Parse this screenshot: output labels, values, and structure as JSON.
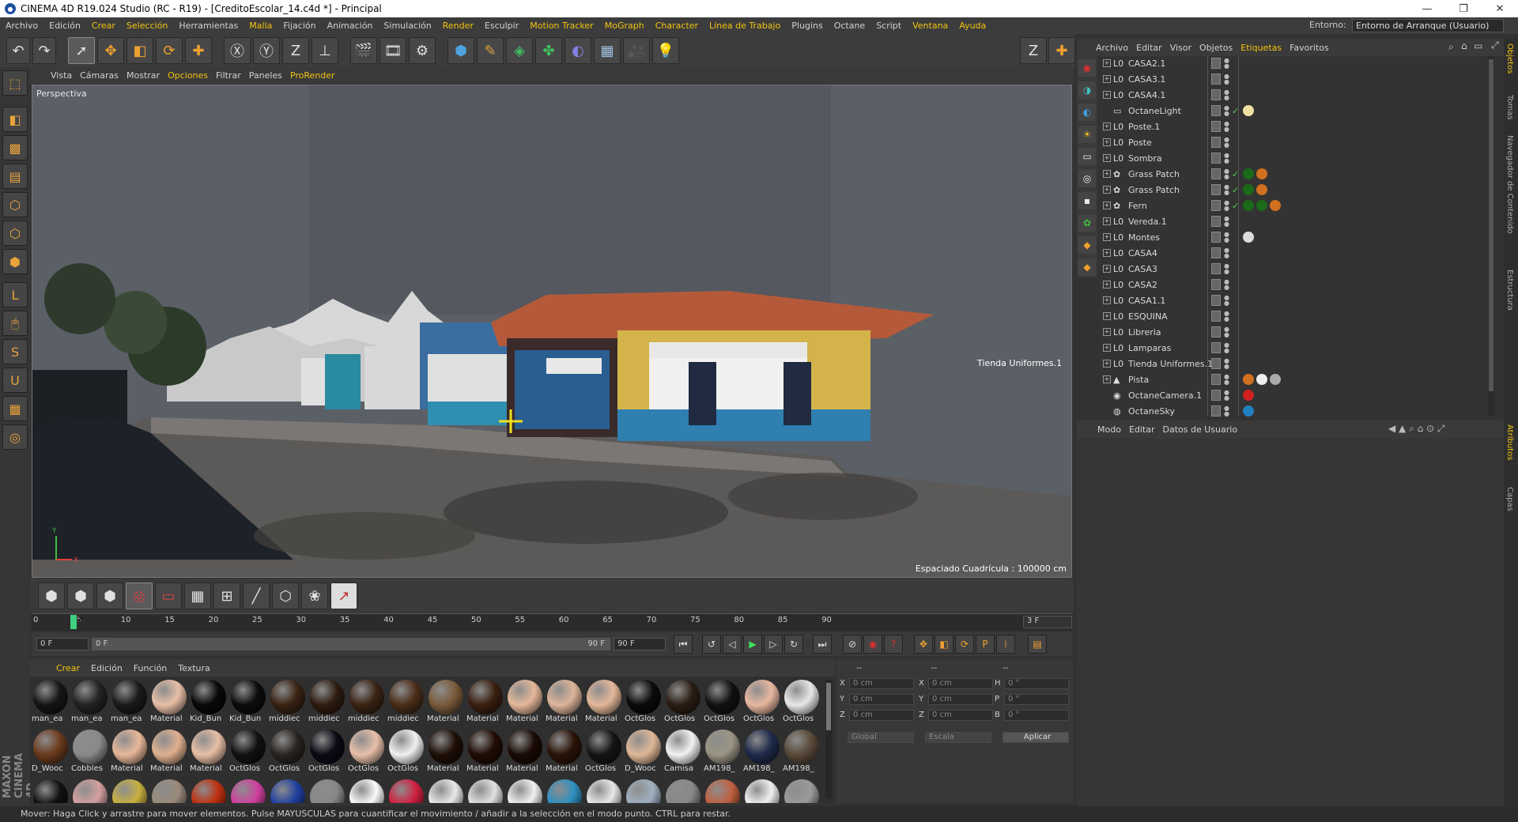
{
  "window": {
    "title": "CINEMA 4D R19.024 Studio (RC - R19) - [CreditoEscolar_14.c4d *] - Principal",
    "minimize": "—",
    "maximize": "❐",
    "close": "✕"
  },
  "menubar": {
    "items": [
      {
        "label": "Archivo",
        "hl": false
      },
      {
        "label": "Edición",
        "hl": false
      },
      {
        "label": "Crear",
        "hl": true
      },
      {
        "label": "Selección",
        "hl": true
      },
      {
        "label": "Herramientas",
        "hl": false
      },
      {
        "label": "Malla",
        "hl": true
      },
      {
        "label": "Fijación",
        "hl": false
      },
      {
        "label": "Animación",
        "hl": false
      },
      {
        "label": "Simulación",
        "hl": false
      },
      {
        "label": "Render",
        "hl": true
      },
      {
        "label": "Esculpir",
        "hl": false
      },
      {
        "label": "Motion Tracker",
        "hl": true
      },
      {
        "label": "MoGraph",
        "hl": true
      },
      {
        "label": "Character",
        "hl": true
      },
      {
        "label": "Línea de Trabajo",
        "hl": true
      },
      {
        "label": "Plugins",
        "hl": false
      },
      {
        "label": "Octane",
        "hl": false
      },
      {
        "label": "Script",
        "hl": false
      },
      {
        "label": "Ventana",
        "hl": true
      },
      {
        "label": "Ayuda",
        "hl": true
      }
    ],
    "env_label": "Entorno:",
    "env_value": "Entorno de Arranque (Usuario)"
  },
  "viewport": {
    "menu": [
      {
        "label": "Vista",
        "hl": false
      },
      {
        "label": "Cámaras",
        "hl": false
      },
      {
        "label": "Mostrar",
        "hl": false
      },
      {
        "label": "Opciones",
        "hl": true
      },
      {
        "label": "Filtrar",
        "hl": false
      },
      {
        "label": "Paneles",
        "hl": false
      },
      {
        "label": "ProRender",
        "hl": true
      }
    ],
    "label": "Perspectiva",
    "grid_info": "Espaciado Cuadrícula : 100000 cm",
    "object_label": "Tienda Uniformes.1"
  },
  "timeline": {
    "ticks": [
      "0",
      "5",
      "10",
      "15",
      "20",
      "25",
      "30",
      "35",
      "40",
      "45",
      "50",
      "55",
      "60",
      "65",
      "70",
      "75",
      "80",
      "85",
      "90"
    ],
    "current": "3",
    "end_field": "3 F",
    "start_frame": "0 F",
    "range_start": "0 F",
    "range_end": "90 F",
    "end_frame": "90 F"
  },
  "material_menu": [
    {
      "label": "Crear",
      "hl": true
    },
    {
      "label": "Edición",
      "hl": false
    },
    {
      "label": "Función",
      "hl": false
    },
    {
      "label": "Textura",
      "hl": false
    }
  ],
  "materials": [
    {
      "name": "man_ea",
      "color": "#151515"
    },
    {
      "name": "man_ea",
      "color": "#222"
    },
    {
      "name": "man_ea",
      "color": "#1a1a1a"
    },
    {
      "name": "Material",
      "color": "#e8bfa6"
    },
    {
      "name": "Kid_Bun",
      "color": "#080808"
    },
    {
      "name": "Kid_Bun",
      "color": "#0c0c0c"
    },
    {
      "name": "middiec",
      "color": "#3a2314"
    },
    {
      "name": "middiec",
      "color": "#2e1c10"
    },
    {
      "name": "middiec",
      "color": "#3a2314"
    },
    {
      "name": "middiec",
      "color": "#4a2d18"
    },
    {
      "name": "Material",
      "color": "#7a5a3a"
    },
    {
      "name": "Material",
      "color": "#3a2010"
    },
    {
      "name": "Material",
      "color": "#e5b89a"
    },
    {
      "name": "Material",
      "color": "#ddb49a"
    },
    {
      "name": "Material",
      "color": "#e5b89a"
    },
    {
      "name": "OctGlos",
      "color": "#0a0a0a"
    },
    {
      "name": "OctGlos",
      "color": "#2b1d14"
    },
    {
      "name": "OctGlos",
      "color": "#111"
    },
    {
      "name": "OctGlos",
      "color": "#e8b8a0"
    },
    {
      "name": "OctGlos",
      "color": "#e8e8e8"
    },
    {
      "name": "D_Wooc",
      "color": "#6b3a1c"
    },
    {
      "name": "Cobbles",
      "color": "#8a8a8a"
    },
    {
      "name": "Material",
      "color": "#e8b89a"
    },
    {
      "name": "Material",
      "color": "#e0b090"
    },
    {
      "name": "Material",
      "color": "#e8bfa6"
    },
    {
      "name": "OctGlos",
      "color": "#111"
    },
    {
      "name": "OctGlos",
      "color": "#2a2420"
    },
    {
      "name": "OctGlos",
      "color": "#0a0a14"
    },
    {
      "name": "OctGlos",
      "color": "#e8bfaa"
    },
    {
      "name": "OctGlos",
      "color": "#f0f0f0"
    },
    {
      "name": "Material",
      "color": "#1e0e06"
    },
    {
      "name": "Material",
      "color": "#200c04"
    },
    {
      "name": "Material",
      "color": "#1a0a04"
    },
    {
      "name": "Material",
      "color": "#2a1408"
    },
    {
      "name": "OctGlos",
      "color": "#151515"
    },
    {
      "name": "D_Wooc",
      "color": "#e0b898"
    },
    {
      "name": "Camisa",
      "color": "#f2f2f2"
    },
    {
      "name": "AM198_",
      "color": "#9a9484"
    },
    {
      "name": "AM198_",
      "color": "#1e2a4a"
    },
    {
      "name": "AM198_",
      "color": "#5a4a3a"
    },
    {
      "name": "",
      "color": "#111"
    },
    {
      "name": "",
      "color": "#d4a0a0"
    },
    {
      "name": "",
      "color": "#c8b040"
    },
    {
      "name": "",
      "color": "#9a8a7a"
    },
    {
      "name": "",
      "color": "#c03010"
    },
    {
      "name": "",
      "color": "#d040a0"
    },
    {
      "name": "",
      "color": "#2040a0"
    },
    {
      "name": "",
      "color": "#888"
    },
    {
      "name": "",
      "color": "#fafafa"
    },
    {
      "name": "",
      "color": "#d02040"
    },
    {
      "name": "",
      "color": "#e8e8e8"
    },
    {
      "name": "",
      "color": "#e0e0e0"
    },
    {
      "name": "",
      "color": "#f0f0f0"
    },
    {
      "name": "",
      "color": "#3090c0"
    },
    {
      "name": "",
      "color": "#e8e8e8"
    },
    {
      "name": "",
      "color": "#a0b0c0"
    },
    {
      "name": "",
      "color": "#888"
    },
    {
      "name": "",
      "color": "#c06040"
    },
    {
      "name": "",
      "color": "#f0f0f0"
    },
    {
      "name": "",
      "color": "#9a9a9a"
    }
  ],
  "coords": {
    "header": [
      "--",
      "--",
      "--"
    ],
    "rows": [
      {
        "a": "X",
        "av": "0 cm",
        "b": "X",
        "bv": "0 cm",
        "c": "H",
        "cv": "0 °"
      },
      {
        "a": "Y",
        "av": "0 cm",
        "b": "Y",
        "bv": "0 cm",
        "c": "P",
        "cv": "0 °"
      },
      {
        "a": "Z",
        "av": "0 cm",
        "b": "Z",
        "bv": "0 cm",
        "c": "B",
        "cv": "0 °"
      }
    ],
    "mode": "Global",
    "scale": "Escala",
    "apply": "Aplicar"
  },
  "objects_menu": [
    {
      "label": "Archivo",
      "hl": false
    },
    {
      "label": "Editar",
      "hl": false
    },
    {
      "label": "Visor",
      "hl": false
    },
    {
      "label": "Objetos",
      "hl": false
    },
    {
      "label": "Etiquetas",
      "hl": true
    },
    {
      "label": "Favoritos",
      "hl": false
    }
  ],
  "objects": [
    {
      "name": "CASA2.1",
      "icon": "L0",
      "exp": "+",
      "check": false,
      "tags": []
    },
    {
      "name": "CASA3.1",
      "icon": "L0",
      "exp": "+",
      "check": false,
      "tags": []
    },
    {
      "name": "CASA4.1",
      "icon": "L0",
      "exp": "+",
      "check": false,
      "tags": []
    },
    {
      "name": "OctaneLight",
      "icon": "▭",
      "exp": "",
      "check": true,
      "tags": [
        "#f1e0a0"
      ]
    },
    {
      "name": "Poste.1",
      "icon": "L0",
      "exp": "+",
      "check": false,
      "tags": []
    },
    {
      "name": "Poste",
      "icon": "L0",
      "exp": "+",
      "check": false,
      "tags": []
    },
    {
      "name": "Sombra",
      "icon": "L0",
      "exp": "+",
      "check": false,
      "tags": []
    },
    {
      "name": "Grass Patch",
      "icon": "✿",
      "exp": "+",
      "check": true,
      "tags": [
        "#1a6a1a",
        "#d07020"
      ]
    },
    {
      "name": "Grass Patch",
      "icon": "✿",
      "exp": "+",
      "check": true,
      "tags": [
        "#1a6a1a",
        "#d07020"
      ]
    },
    {
      "name": "Fern",
      "icon": "✿",
      "exp": "+",
      "check": true,
      "tags": [
        "#1a6a1a",
        "#1a6a1a",
        "#d07020"
      ]
    },
    {
      "name": "Vereda.1",
      "icon": "L0",
      "exp": "+",
      "check": false,
      "tags": []
    },
    {
      "name": "Montes",
      "icon": "L0",
      "exp": "+",
      "check": false,
      "tags": [
        "#dddddd"
      ]
    },
    {
      "name": "CASA4",
      "icon": "L0",
      "exp": "+",
      "check": false,
      "tags": []
    },
    {
      "name": "CASA3",
      "icon": "L0",
      "exp": "+",
      "check": false,
      "tags": []
    },
    {
      "name": "CASA2",
      "icon": "L0",
      "exp": "+",
      "check": false,
      "tags": []
    },
    {
      "name": "CASA1.1",
      "icon": "L0",
      "exp": "+",
      "check": false,
      "tags": []
    },
    {
      "name": "ESQUINA",
      "icon": "L0",
      "exp": "+",
      "check": false,
      "tags": []
    },
    {
      "name": "Libreria",
      "icon": "L0",
      "exp": "+",
      "check": false,
      "tags": []
    },
    {
      "name": "Lamparas",
      "icon": "L0",
      "exp": "+",
      "check": false,
      "tags": []
    },
    {
      "name": "Tienda Uniformes.1",
      "icon": "L0",
      "exp": "+",
      "check": false,
      "tags": []
    },
    {
      "name": "Pista",
      "icon": "▲",
      "exp": "+",
      "check": false,
      "tags": [
        "#d07020",
        "#eeeeee",
        "#aaaaaa"
      ]
    },
    {
      "name": "OctaneCamera.1",
      "icon": "◉",
      "exp": "",
      "check": false,
      "tags": [
        "#d02020"
      ]
    },
    {
      "name": "OctaneSky",
      "icon": "◍",
      "exp": "",
      "check": false,
      "tags": [
        "#2080c0"
      ]
    }
  ],
  "attr_menu": [
    {
      "label": "Modo",
      "hl": false
    },
    {
      "label": "Editar",
      "hl": false
    },
    {
      "label": "Datos de Usuario",
      "hl": false
    }
  ],
  "right_tabs": [
    {
      "label": "Objetos",
      "active": true
    },
    {
      "label": "Tomas",
      "active": false
    },
    {
      "label": "Navegador de Contenido",
      "active": false
    },
    {
      "label": "Estructura",
      "active": false
    },
    {
      "label": "Atributos",
      "active": true
    },
    {
      "label": "Capas",
      "active": false
    }
  ],
  "brand": "MAXON CINEMA 4D",
  "status": "Mover: Haga Click y arrastre para mover elementos. Pulse MAYUSCULAS para cuantificar el movimiento / añadir a la selección en el modo punto. CTRL para restar."
}
